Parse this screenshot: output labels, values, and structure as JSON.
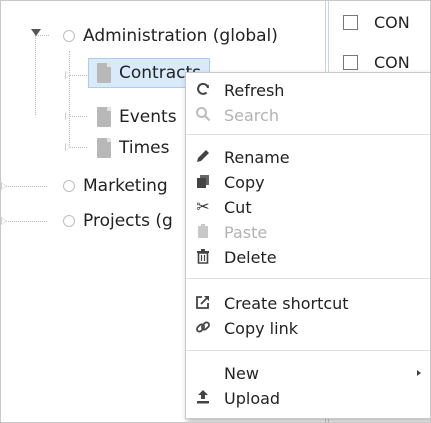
{
  "tree": {
    "items": [
      {
        "label": "Administration (global)",
        "icon": "circle-icon"
      },
      {
        "label": "Contracts",
        "icon": "document-icon",
        "selected": true
      },
      {
        "label": "Events",
        "icon": "document-icon"
      },
      {
        "label": "Times",
        "icon": "document-icon"
      },
      {
        "label": "Marketing",
        "icon": "circle-icon"
      },
      {
        "label": "Projects (g",
        "icon": "circle-icon"
      }
    ]
  },
  "list": {
    "rows": [
      {
        "label": "CON"
      },
      {
        "label": "CON"
      }
    ]
  },
  "context_menu": {
    "items": [
      {
        "label": "Refresh",
        "icon": "refresh-icon",
        "enabled": true
      },
      {
        "label": "Search",
        "icon": "search-icon",
        "enabled": false
      },
      {
        "label": "Rename",
        "icon": "pencil-icon",
        "enabled": true
      },
      {
        "label": "Copy",
        "icon": "copy-icon",
        "enabled": true
      },
      {
        "label": "Cut",
        "icon": "scissors-icon",
        "enabled": true
      },
      {
        "label": "Paste",
        "icon": "clipboard-icon",
        "enabled": false
      },
      {
        "label": "Delete",
        "icon": "trash-icon",
        "enabled": true
      },
      {
        "label": "Create shortcut",
        "icon": "shortcut-icon",
        "enabled": true
      },
      {
        "label": "Copy link",
        "icon": "link-icon",
        "enabled": true
      },
      {
        "label": "New",
        "icon": "",
        "enabled": true,
        "submenu": true
      },
      {
        "label": "Upload",
        "icon": "upload-icon",
        "enabled": true
      }
    ]
  },
  "colors": {
    "selection_bg": "#d9ebfa",
    "selection_border": "#a9cdee",
    "disabled_text": "#b3b3b3"
  }
}
